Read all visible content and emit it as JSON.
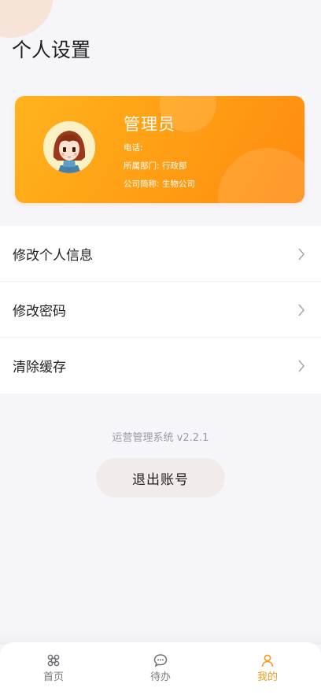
{
  "page": {
    "title": "个人设置"
  },
  "profile": {
    "name": "管理员",
    "phone": "电话:",
    "department": "所属部门: 行政部",
    "company": "公司简称: 生物公司"
  },
  "menu": {
    "items": [
      {
        "label": "修改个人信息",
        "icon": "chevron-right-icon"
      },
      {
        "label": "修改密码",
        "icon": "chevron-right-icon"
      },
      {
        "label": "清除缓存",
        "icon": "chevron-right-icon"
      }
    ]
  },
  "footer": {
    "version": "运营管理系统 v2.2.1",
    "logout_label": "退出账号"
  },
  "tabbar": {
    "active_color": "#f59a1b",
    "tabs": [
      {
        "label": "首页",
        "icon": "command-icon",
        "active": false
      },
      {
        "label": "待办",
        "icon": "chat-icon",
        "active": false
      },
      {
        "label": "我的",
        "icon": "user-icon",
        "active": true
      }
    ]
  }
}
